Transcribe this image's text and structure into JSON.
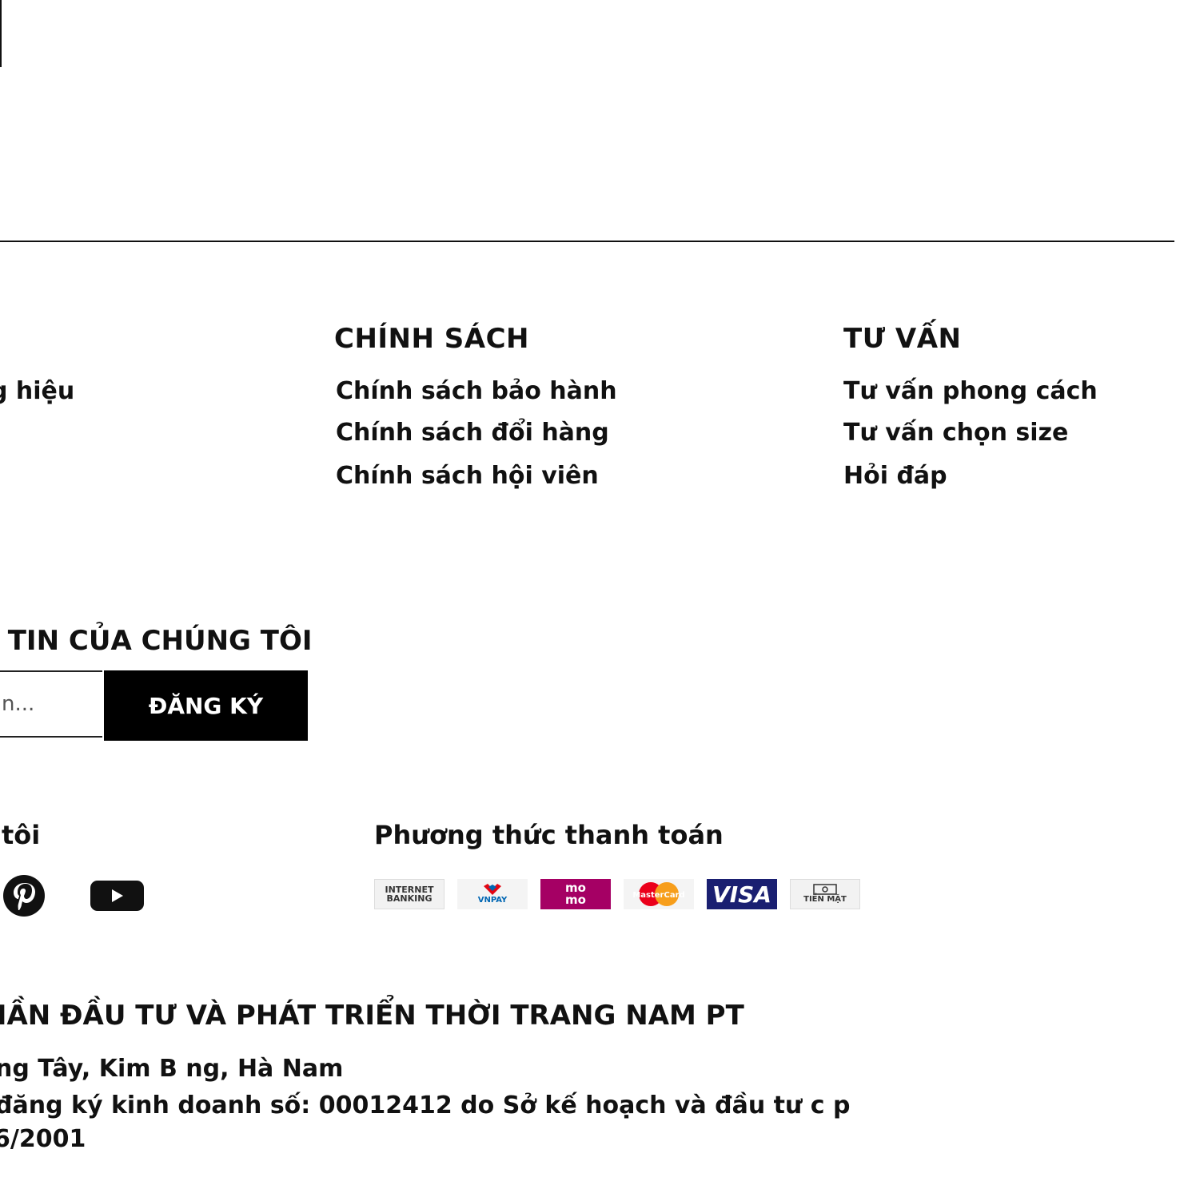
{
  "footer": {
    "policy": {
      "title": "CHÍNH SÁCH",
      "links": [
        "Chính sách bảo hành",
        "Chính sách  đổi hàng",
        "Chính sách hội viên"
      ]
    },
    "advice": {
      "title": "TƯ VẤN",
      "links": [
        "Tư  vấn phong cách",
        "Tư  vấn chọn size",
        "Hỏi  đáp"
      ]
    },
    "about": {
      "partial_link": "g hiệu"
    },
    "newsletter": {
      "title": "G TIN CỦA CHÚNG TÔI",
      "placeholder": "n...",
      "button_label": "ĐĂNG KÝ"
    },
    "social": {
      "title": "tôi",
      "icons": [
        "pinterest-icon",
        "youtube-icon"
      ]
    },
    "payment": {
      "title": "Phương thức thanh toán",
      "methods": [
        {
          "name": "internet-banking",
          "label_line1": "INTERNET",
          "label_line2": "BANKING"
        },
        {
          "name": "vnpay",
          "label_line1": "VNPAY"
        },
        {
          "name": "momo",
          "label_line1": "mo",
          "label_line2": "mo",
          "color": "#a50064"
        },
        {
          "name": "mastercard",
          "label_line1": "MasterCard"
        },
        {
          "name": "visa",
          "label_line1": "VISA",
          "color": "#1a1f71"
        },
        {
          "name": "cash",
          "label_line1": "TIỀN MẶT"
        }
      ]
    },
    "company": {
      "name": "HẦN ĐẦU TƯ   VÀ PHÁT TRIỂN THỜI TRANG NAM PT",
      "address": "ng Tây, Kim B ng, Hà Nam",
      "license": "đăng ký kinh doanh số: 00012412 do Sở  kế  hoạch và   đầu tư   c p",
      "date": "6/2001"
    }
  }
}
